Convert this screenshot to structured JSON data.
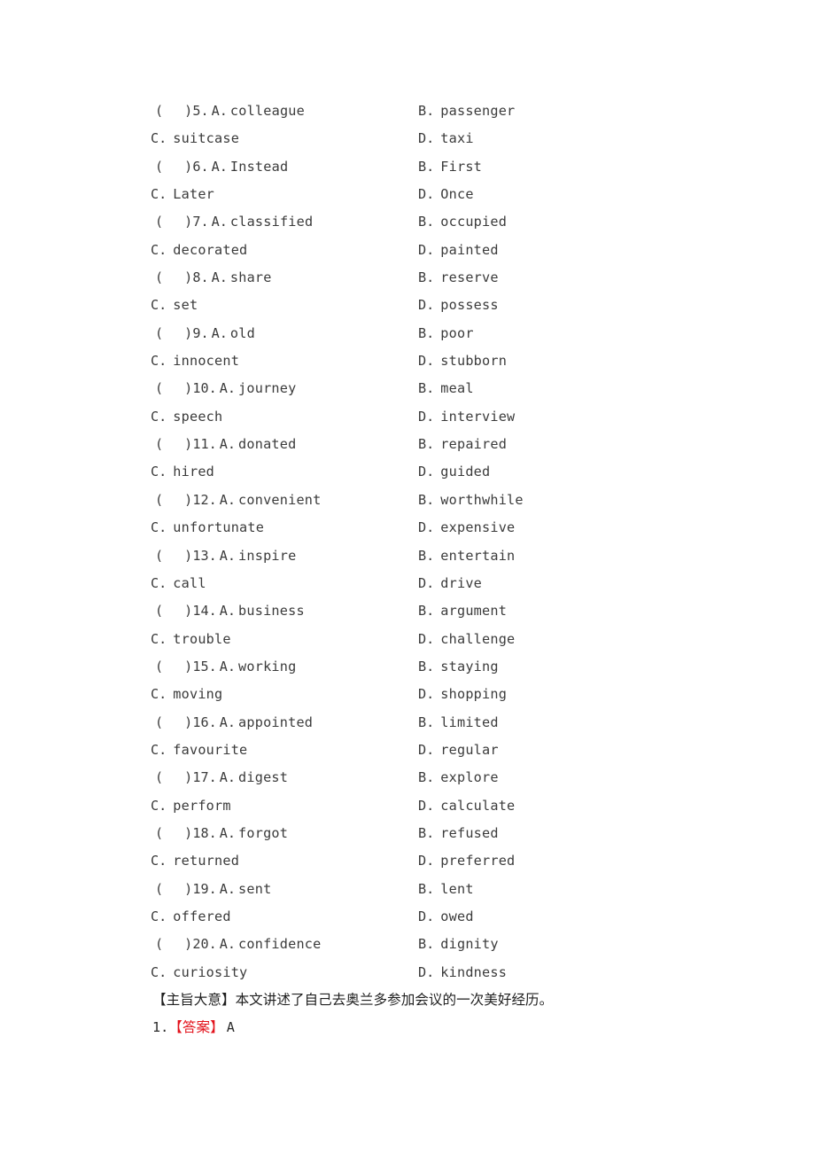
{
  "document": {
    "type": "english-cloze-test-answer-key",
    "text_color": "#3b3b3b",
    "accent_color": "#e3121b",
    "background_color": "#ffffff"
  },
  "questions": [
    {
      "number": "5.",
      "a_label": "A.",
      "a_text": "colleague",
      "b_label": "B.",
      "b_text": "passenger",
      "c_label": "C.",
      "c_text": "suitcase",
      "d_label": "D.",
      "d_text": "taxi"
    },
    {
      "number": "6.",
      "a_label": "A.",
      "a_text": "Instead",
      "b_label": "B.",
      "b_text": "First",
      "c_label": "C.",
      "c_text": "Later",
      "d_label": "D.",
      "d_text": "Once"
    },
    {
      "number": "7.",
      "a_label": "A.",
      "a_text": "classified",
      "b_label": "B.",
      "b_text": "occupied",
      "c_label": "C.",
      "c_text": "decorated",
      "d_label": "D.",
      "d_text": "painted"
    },
    {
      "number": "8.",
      "a_label": "A.",
      "a_text": "share",
      "b_label": "B.",
      "b_text": "reserve",
      "c_label": "C.",
      "c_text": "set",
      "d_label": "D.",
      "d_text": "possess"
    },
    {
      "number": "9.",
      "a_label": "A.",
      "a_text": "old",
      "b_label": "B.",
      "b_text": "poor",
      "c_label": "C.",
      "c_text": "innocent",
      "d_label": "D.",
      "d_text": "stubborn"
    },
    {
      "number": "10.",
      "a_label": "A.",
      "a_text": "journey",
      "b_label": "B.",
      "b_text": "meal",
      "c_label": "C.",
      "c_text": "speech",
      "d_label": "D.",
      "d_text": "interview"
    },
    {
      "number": "11.",
      "a_label": "A.",
      "a_text": "donated",
      "b_label": "B.",
      "b_text": "repaired",
      "c_label": "C.",
      "c_text": "hired",
      "d_label": "D.",
      "d_text": "guided"
    },
    {
      "number": "12.",
      "a_label": "A.",
      "a_text": "convenient",
      "b_label": "B.",
      "b_text": "worthwhile",
      "c_label": "C.",
      "c_text": "unfortunate",
      "d_label": "D.",
      "d_text": "expensive"
    },
    {
      "number": "13.",
      "a_label": "A.",
      "a_text": "inspire",
      "b_label": "B.",
      "b_text": "entertain",
      "c_label": "C.",
      "c_text": "call",
      "d_label": "D.",
      "d_text": "drive"
    },
    {
      "number": "14.",
      "a_label": "A.",
      "a_text": "business",
      "b_label": "B.",
      "b_text": "argument",
      "c_label": "C.",
      "c_text": "trouble",
      "d_label": "D.",
      "d_text": "challenge"
    },
    {
      "number": "15.",
      "a_label": "A.",
      "a_text": "working",
      "b_label": "B.",
      "b_text": "staying",
      "c_label": "C.",
      "c_text": "moving",
      "d_label": "D.",
      "d_text": "shopping"
    },
    {
      "number": "16.",
      "a_label": "A.",
      "a_text": "appointed",
      "b_label": "B.",
      "b_text": "limited",
      "c_label": "C.",
      "c_text": "favourite",
      "d_label": "D.",
      "d_text": "regular"
    },
    {
      "number": "17.",
      "a_label": "A.",
      "a_text": "digest",
      "b_label": "B.",
      "b_text": "explore",
      "c_label": "C.",
      "c_text": "perform",
      "d_label": "D.",
      "d_text": "calculate"
    },
    {
      "number": "18.",
      "a_label": "A.",
      "a_text": "forgot",
      "b_label": "B.",
      "b_text": "refused",
      "c_label": "C.",
      "c_text": "returned",
      "d_label": "D.",
      "d_text": "preferred"
    },
    {
      "number": "19.",
      "a_label": "A.",
      "a_text": "sent",
      "b_label": "B.",
      "b_text": "lent",
      "c_label": "C.",
      "c_text": "offered",
      "d_label": "D.",
      "d_text": "owed"
    },
    {
      "number": "20.",
      "a_label": "A.",
      "a_text": "confidence",
      "b_label": "B.",
      "b_text": "dignity",
      "c_label": "C.",
      "c_text": "curiosity",
      "d_label": "D.",
      "d_text": "kindness"
    }
  ],
  "summary": {
    "text": "【主旨大意】本文讲述了自己去奥兰多参加会议的一次美好经历。"
  },
  "answers": [
    {
      "number": "1.",
      "tag": "【答案】",
      "value": "A"
    }
  ],
  "glyphs": {
    "open_paren": "(",
    "close_paren": ")"
  }
}
